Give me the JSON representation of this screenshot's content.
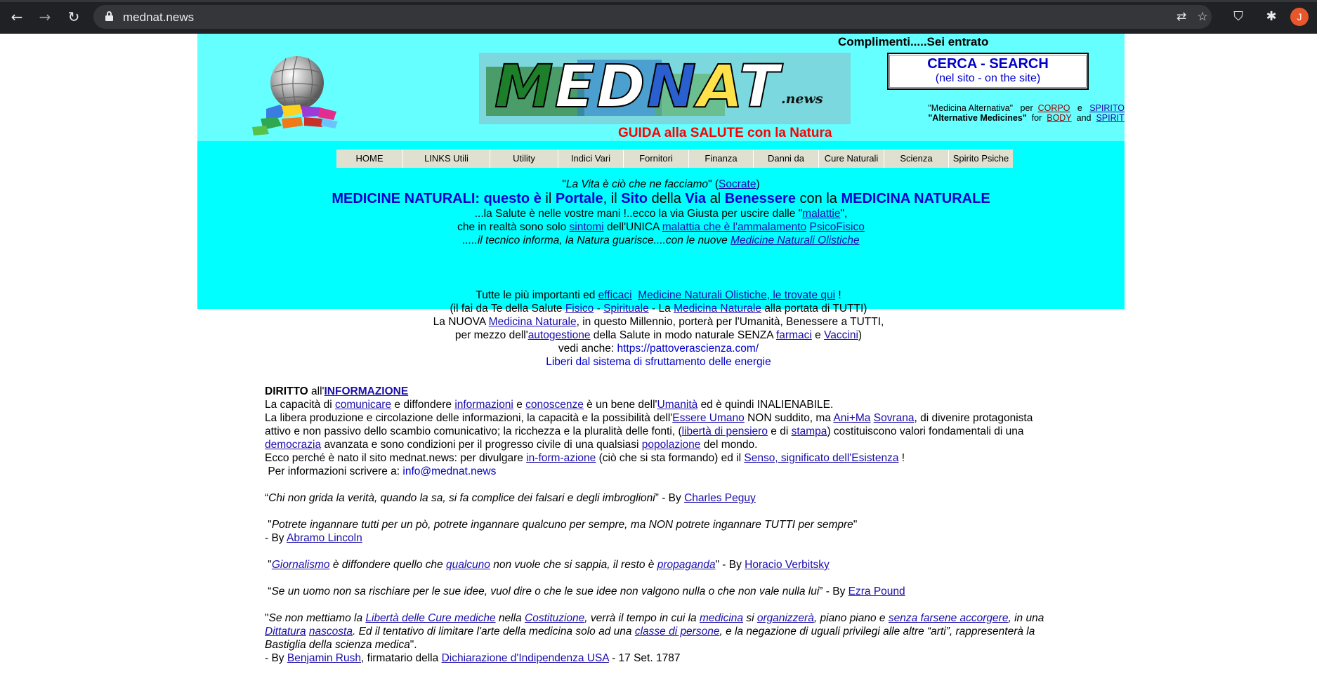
{
  "browser": {
    "url": "mednat.news",
    "profile_initial": "J"
  },
  "header": {
    "welcome": "Complimenti.....Sei entrato",
    "logo_word": "MEDNAT",
    "logo_suffix": ".news",
    "tagline": "GUIDA  alla  SALUTE con la Natura",
    "search_title": "CERCA  -  SEARCH",
    "search_sub": "(nel sito - on the site)",
    "alt_it": "\"Medicina Alternativa\"",
    "alt_it_per": "per",
    "alt_it_corpo": "CORPO",
    "alt_it_e": "e",
    "alt_it_spirito": "SPIRITO",
    "alt_en": "\"Alternative Medicines\"",
    "alt_en_for": "for",
    "alt_en_body": "BODY",
    "alt_en_and": "and",
    "alt_en_spirit": "SPIRIT"
  },
  "menu": [
    {
      "label": "HOME"
    },
    {
      "label": "LINKS Utili"
    },
    {
      "label": "Utility"
    },
    {
      "label": "Indici Vari"
    },
    {
      "label": "Fornitori"
    },
    {
      "label": "Finanza"
    },
    {
      "label": "Danni da"
    },
    {
      "label": "Cure Naturali"
    },
    {
      "label": "Scienza"
    },
    {
      "label": "Spirito Psiche"
    }
  ],
  "intro": {
    "quote": "La Vita è ciò che ne facciamo",
    "quote_author": "Socrate",
    "l2_a": "MEDICINE NATURALI: questo è",
    "l2_il": "il",
    "l2_portale": "Portale",
    "l2_il2": ", il",
    "l2_sito": "Sito",
    "l2_della": "della",
    "l2_via": "Via",
    "l2_al": "al",
    "l2_benessere": "Benessere",
    "l2_conla": "con la",
    "l2_medicina": "MEDICINA NATURALE",
    "l3_a": "...la Salute è nelle vostre mani !..ecco la via Giusta per uscire dalle \"",
    "l3_link": "malattie",
    "l3_b": "\",",
    "l4_a": "che in realtà sono solo",
    "l4_sintomi": "sintomi",
    "l4_b": "dell'UNICA",
    "l4_malattia": "malattia che è l'ammalamento",
    "l4_psico": "PsicoFisico",
    "l5_a": ".....il tecnico informa, la Natura guarisce....con le nuove",
    "l5_link": "Medicine Naturali Olistiche"
  },
  "middle": {
    "m1_a": "Tutte le più importanti ed",
    "m1_efficaci": "efficaci",
    "m1_link": "Medicine Naturali Olistiche, le trovate qui",
    "m1_b": "!",
    "m2_a": "(il fai da Te della Salute",
    "m2_fisico": "Fisico",
    "m2_dash1": "-",
    "m2_spirituale": "Spirituale",
    "m2_b": "- La",
    "m2_medicina": "Medicina Naturale",
    "m2_c": "alla portata di TUTTI)",
    "m3_a": "La NUOVA",
    "m3_link": "Medicina Naturale",
    "m3_b": ", in questo Millennio, porterà per l'Umanità, Benessere a TUTTI,",
    "m4_a": "per mezzo dell'",
    "m4_auto": "autogestione",
    "m4_b": "della Salute in modo naturale SENZA",
    "m4_farmaci": "farmaci",
    "m4_e": "e",
    "m4_vaccini": "Vaccini",
    "m4_c": ")",
    "m5_a": "vedi anche:",
    "m5_link": "https://pattoverascienza.com/",
    "m6": "Liberi dal sistema di sfruttamento delle energie"
  },
  "body": {
    "diritto": "DIRITTO",
    "all": "all'",
    "informazione": "INFORMAZIONE",
    "p1_a": "La capacità di",
    "p1_comunicare": "comunicare",
    "p1_b": "e diffondere",
    "p1_informazioni": "informazioni",
    "p1_e": "e",
    "p1_conoscenze": "conoscenze",
    "p1_c": "è un bene dell'",
    "p1_umanita": "Umanità",
    "p1_d": "ed è quindi INALIENABILE.",
    "p2_a": "La libera produzione e circolazione delle informazioni, la capacità e  la possibilità dell'",
    "p2_essere": "Essere Umano",
    "p2_b": "NON suddito, ma",
    "p2_anima": "Ani+Ma",
    "p2_sovrana": "Sovrana",
    "p2_c": ", di divenire protagonista attivo e non passivo dello scambio comunicativo;  la ricchezza e la pluralità delle fonti, (",
    "p2_liberta": "libertà di pensiero",
    "p2_d": "e di",
    "p2_stampa": "stampa",
    "p2_e": ") costituiscono valori fondamentali di una",
    "p2_democrazia": "democrazia",
    "p2_f": "avanzata e sono condizioni per il progresso civile di una qualsiasi",
    "p2_popolazione": "popolazione",
    "p2_g": "del mondo.",
    "p3_a": "Ecco perché è nato il sito mednat.news: per divulgare",
    "p3_inform": "in-form-azione",
    "p3_b": "(ciò che si sta formando) ed il",
    "p3_senso": "Senso, significato dell'Esistenza",
    "p3_c": "!",
    "p4_a": "Per informazioni scrivere a:",
    "p4_email": "info@mednat.news",
    "q1_text": "Chi non grida la verità, quando la sa, si fa complice dei falsari e degli imbroglioni",
    "q1_by": "- By",
    "q1_author": "Charles Peguy",
    "q2_text": "Potrete ingannare tutti per un pò, potrete ingannare qualcuno per sempre, ma NON potrete ingannare TUTTI per sempre",
    "q2_by": "- By",
    "q2_author": "Abramo Lincoln",
    "q3_giornalismo": "Giornalismo",
    "q3_a": "è diffondere quello che",
    "q3_qualcuno": "qualcuno",
    "q3_b": "non vuole che si sappia, il resto è",
    "q3_propaganda": "propaganda",
    "q3_by": "- By",
    "q3_author": "Horacio Verbitsky",
    "q4_text": "Se un uomo non sa rischiare per le sue idee, vuol dire o che le sue idee non valgono nulla o che non vale nulla lui",
    "q4_by": "- By",
    "q4_author": "Ezra Pound",
    "q5_a": "Se non mettiamo la",
    "q5_liberta": "Libertà delle Cure mediche",
    "q5_b": "nella",
    "q5_costituzione": "Costituzione",
    "q5_c": ", verrà il tempo in cui la",
    "q5_medicina": "medicina",
    "q5_d": "si",
    "q5_organizzera": "organizzerà",
    "q5_e": ", piano piano e",
    "q5_senza": "senza farsene accorgere",
    "q5_f": ", in una",
    "q5_dittatura": "Dittatura",
    "q5_nascosta": "nascosta",
    "q5_g": ". Ed il tentativo di limitare l'arte della medicina solo ad una",
    "q5_classe": "classe di persone",
    "q5_h": ", e la negazione di uguali privilegi alle altre “arti”, rappresenterà la Bastiglia della scienza medica",
    "q5_by": "- By",
    "q5_author": "Benjamin Rush",
    "q5_i": ", firmatario  della",
    "q5_dichiarazione": "Dichiarazione  d'Indipendenza USA",
    "q5_date": "- 17 Set. 1787"
  }
}
